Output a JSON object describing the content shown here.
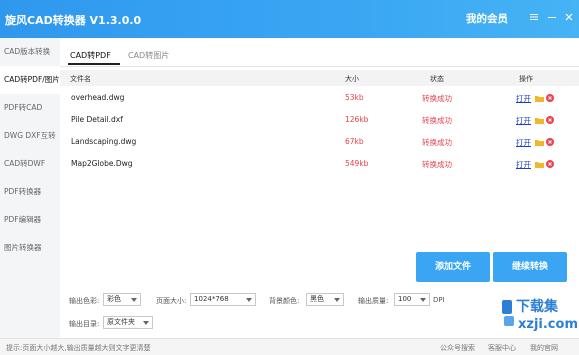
{
  "app": {
    "title": "旋风CAD转换器 V1.3.0.0",
    "member_label": "我的会员",
    "window_controls": {
      "menu_icon": "hamburger-icon",
      "minimize_icon": "minimize-icon",
      "close_icon": "close-icon"
    }
  },
  "sidebar": {
    "items": [
      {
        "label": "CAD版本转换",
        "active": false
      },
      {
        "label": "CAD转PDF/图片",
        "active": true
      },
      {
        "label": "PDF转CAD",
        "active": false
      },
      {
        "label": "DWG DXF互转",
        "active": false
      },
      {
        "label": "CAD转DWF",
        "active": false
      },
      {
        "label": "PDF转换器",
        "active": false
      },
      {
        "label": "PDF编辑器",
        "active": false
      },
      {
        "label": "图片转换器",
        "active": false
      }
    ]
  },
  "tabs": [
    {
      "label": "CAD转PDF",
      "active": true
    },
    {
      "label": "CAD转图片",
      "active": false
    }
  ],
  "table": {
    "headers": {
      "name": "文件名",
      "size": "大小",
      "status": "状态",
      "action": "操作"
    },
    "rows": [
      {
        "name": "overhead.dwg",
        "size": "53kb",
        "status": "转换成功",
        "open": "打开"
      },
      {
        "name": "Pile Detail.dxf",
        "size": "126kb",
        "status": "转换成功",
        "open": "打开"
      },
      {
        "name": "Landscaping.dwg",
        "size": "67kb",
        "status": "转换成功",
        "open": "打开"
      },
      {
        "name": "Map2Globe.Dwg",
        "size": "549kb",
        "status": "转换成功",
        "open": "打开"
      }
    ],
    "row_icons": {
      "folder": "folder-icon",
      "delete": "delete-icon"
    }
  },
  "actions": {
    "add_file": "添加文件",
    "continue_convert": "继续转换"
  },
  "settings": {
    "output_color": {
      "label": "输出色彩:",
      "value": "彩色"
    },
    "page_size": {
      "label": "页面大小:",
      "value": "1024*768"
    },
    "background_color": {
      "label": "背景颜色:",
      "value": "黑色"
    },
    "output_quality": {
      "label": "输出质量:",
      "value": "100",
      "unit": "DPI"
    },
    "output_dir": {
      "label": "输出目录:",
      "value": "原文件夹"
    }
  },
  "statusbar": {
    "hint": "提示:页面大小越大,输出质量越大则文字更清楚",
    "links": [
      "公众号搜索",
      "客服中心",
      "我的官网"
    ]
  },
  "watermark": {
    "top": "下载集",
    "bottom": "xzji.com"
  },
  "colors": {
    "accent": "#3aa6f3",
    "success_text": "#e8424d",
    "link": "#1a3fbf"
  }
}
